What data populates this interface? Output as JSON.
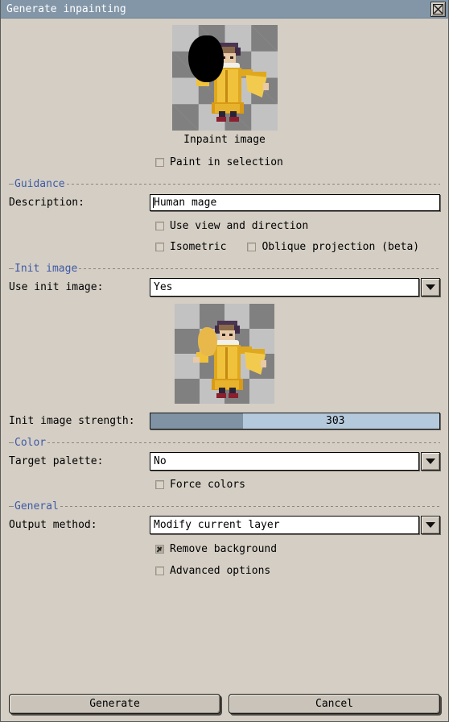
{
  "window": {
    "title": "Generate inpainting",
    "close_icon": "close-x-icon"
  },
  "preview": {
    "caption": "Inpaint image"
  },
  "paint_in_selection": {
    "label": "Paint in selection",
    "checked": false
  },
  "guidance": {
    "section_title": "Guidance",
    "description_label": "Description:",
    "description_value": "Human mage",
    "description_placeholder": "",
    "use_view_and_direction": {
      "label": "Use view and direction",
      "checked": false
    },
    "isometric": {
      "label": "Isometric",
      "checked": false
    },
    "oblique_projection": {
      "label": "Oblique projection (beta)",
      "checked": false
    }
  },
  "init_image": {
    "section_title": "Init image",
    "use_init_image_label": "Use init image:",
    "use_init_image_value": "Yes",
    "strength_label": "Init image strength:",
    "strength_value": "303",
    "strength_percent": 32
  },
  "color": {
    "section_title": "Color",
    "target_palette_label": "Target palette:",
    "target_palette_value": "No",
    "force_colors": {
      "label": "Force colors",
      "checked": false
    }
  },
  "general": {
    "section_title": "General",
    "output_method_label": "Output method:",
    "output_method_value": "Modify current layer",
    "remove_background": {
      "label": "Remove background",
      "checked": true
    },
    "advanced_options": {
      "label": "Advanced options",
      "checked": false
    }
  },
  "footer": {
    "generate_label": "Generate",
    "cancel_label": "Cancel"
  },
  "colors": {
    "titlebar": "#8296a8",
    "dialog_background": "#d4cec4",
    "section_title": "#3f5aa6",
    "slider_fill": "#7f93a4",
    "slider_track": "#b5c9dd",
    "robe": "#e0a81f",
    "checker_light": "#c2c2c2",
    "checker_dark": "#808080"
  }
}
